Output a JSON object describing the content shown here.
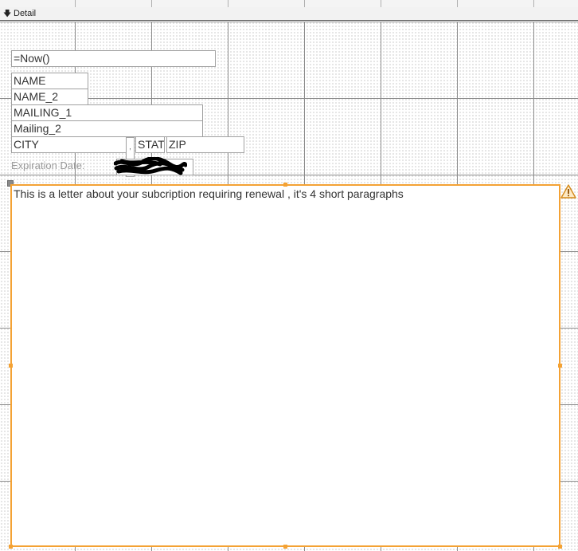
{
  "section": {
    "label": "Detail",
    "arrow_icon": "section-down-arrow-icon"
  },
  "fields": {
    "date_formula": "=Now()",
    "name": "NAME",
    "name_2": "NAME_2",
    "mailing_1": "MAILING_1",
    "mailing_2": "Mailing_2",
    "city": "CITY",
    "state": "STAT",
    "zip": "ZIP",
    "expiration_label": "Expiration Date:",
    "separator": ","
  },
  "letter": {
    "body": "This is a letter about your subcription requiring renewal , it's 4 short paragraphs"
  },
  "colors": {
    "selection": "#f4a234",
    "warning": "#f4a234",
    "grid_line": "#8c8c8c"
  },
  "icons": {
    "warning": "warning-triangle-icon",
    "move_handle": "move-handle-icon"
  }
}
